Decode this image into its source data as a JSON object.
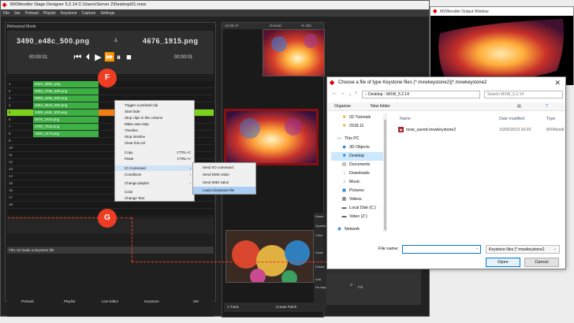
{
  "app": {
    "title": "MXWendler Stage Designer 5.2.14  C:\\Users\\Server 2\\Desktop\\01.mxw",
    "menu": [
      "File",
      "Set",
      "Preload",
      "Playlist",
      "Keystone",
      "Capture",
      "Settings"
    ],
    "mode": "Rehearsal Mode",
    "current_clip": "3490_e48c_500.png",
    "next_clip": "4676_1915.png",
    "separator": "&",
    "time_left": "00:00:01",
    "time_right": "00:00:01",
    "transport_icons": [
      "skip-back-icon",
      "step-back-icon",
      "play-icon",
      "fast-forward-icon",
      "pause-icon",
      "stop-icon"
    ]
  },
  "grid": {
    "rows": [
      {
        "num": "1",
        "clip": "0224_4b52_png"
      },
      {
        "num": "2",
        "clip": "0264_476e_500.png"
      },
      {
        "num": "3",
        "clip": "0909_ae6a_500.png"
      },
      {
        "num": "4",
        "clip": "3464_2943_500.png"
      },
      {
        "num": "5",
        "clip": "3490_e48c_500.png"
      },
      {
        "num": "6",
        "clip": "4676_1915.png"
      },
      {
        "num": "7",
        "clip": "4790_7043.png"
      },
      {
        "num": "8",
        "clip": "7606_c674.png"
      },
      {
        "num": "9",
        "clip": ""
      },
      {
        "num": "10",
        "clip": ""
      },
      {
        "num": "11",
        "clip": ""
      },
      {
        "num": "12",
        "clip": ""
      },
      {
        "num": "13",
        "clip": ""
      },
      {
        "num": "14",
        "clip": ""
      },
      {
        "num": "15",
        "clip": ""
      },
      {
        "num": "16",
        "clip": ""
      },
      {
        "num": "17",
        "clip": ""
      },
      {
        "num": "18",
        "clip": ""
      }
    ]
  },
  "context_menu": {
    "items": [
      "Trigger a preload clip",
      "Start fade",
      "Stop clips in this column",
      "Make auto step",
      "Timeline",
      "Stop timeline",
      "Clear this cel",
      "Copy",
      "Paste",
      "IO Command",
      "Conditions",
      "Change playlist",
      "Color",
      "Change Text"
    ],
    "copy_shortcut": "CTRL+C",
    "paste_shortcut": "CTRL+V",
    "submenu": [
      "Send I/O command",
      "Send DMX value",
      "Send MIDI value",
      "Load a keystone file"
    ]
  },
  "annotations": {
    "f": "F",
    "g": "G"
  },
  "status": "This cel loads a keystone file",
  "bottom_tabs": [
    "Preload",
    "Playlist",
    "Live Editor",
    "Keystone",
    "Set"
  ],
  "preview": {
    "time": "16:35:47",
    "mode": "Normal",
    "zoom": "% 100",
    "footer_left": "1 Track",
    "footer_right": "Create Patch",
    "side_labels": [
      "Reset",
      "Opacity",
      "Color",
      "Scale",
      "Rotate",
      "Add"
    ],
    "side_small": "Ho wap",
    "fill_label": "Fill",
    "zoom_icon": "magnifier-icon"
  },
  "output_window": {
    "title": "MXWendler Output Window"
  },
  "dialog": {
    "title": "Choose a file of type  Keystone files (*.mxwkeystone2)|*.mxwkeystone2",
    "path": [
      "Desktop",
      "MXW_5.2.14"
    ],
    "search_placeholder": "Search MXW_5.2.14",
    "organize": "Organize",
    "new_folder": "New folder",
    "tree": [
      "02-Tutorials",
      "2018.11",
      "This PC",
      "3D Objects",
      "Desktop",
      "Documents",
      "Downloads",
      "Music",
      "Pictures",
      "Videos",
      "Local Disk (C:)",
      "Video (Z:)",
      "Network"
    ],
    "columns": [
      "Name",
      "Date modified",
      "Type"
    ],
    "files": [
      {
        "name": "mxw_saved.mxwkeystone2",
        "date": "15/05/2019 16:03",
        "type": "MXWendl"
      }
    ],
    "file_name_label": "File name:",
    "file_name_value": "",
    "file_type": "Keystone files (*.mxwkeystone2",
    "open_label": "Open",
    "cancel_label": "Cancel"
  },
  "colors": {
    "accent": "#ef3d24",
    "clip_green": "#3cb043",
    "selected_row": "#7cd21a",
    "orange": "#f07e12",
    "win_blue": "#0078d7"
  }
}
